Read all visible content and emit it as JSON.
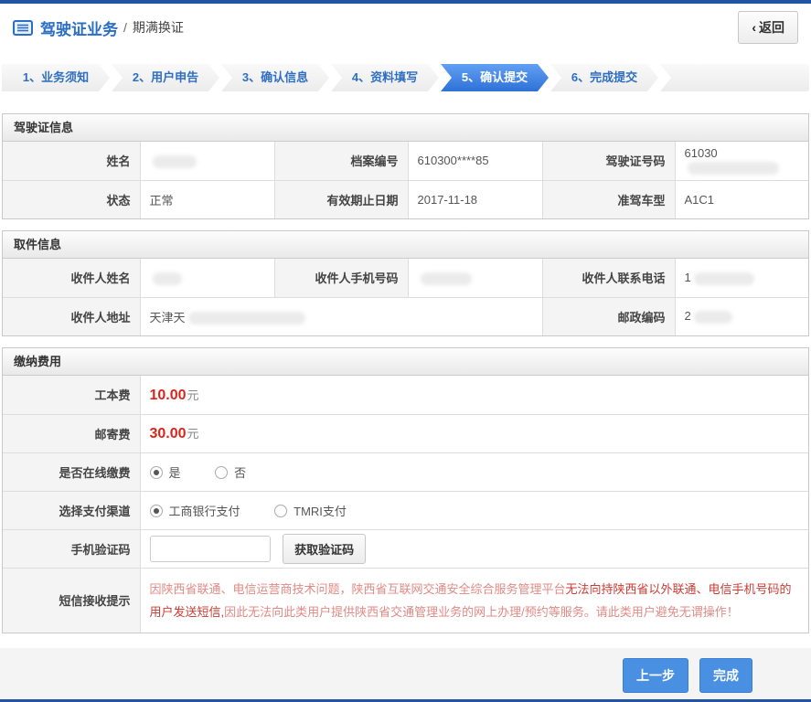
{
  "header": {
    "title": "驾驶证业务",
    "crumb_sep": "/",
    "subtitle": "期满换证",
    "back_arrow": "‹",
    "back_label": "返回"
  },
  "steps": [
    {
      "label": "1、业务须知",
      "active": false
    },
    {
      "label": "2、用户申告",
      "active": false
    },
    {
      "label": "3、确认信息",
      "active": false
    },
    {
      "label": "4、资料填写",
      "active": false
    },
    {
      "label": "5、确认提交",
      "active": true
    },
    {
      "label": "6、完成提交",
      "active": false
    }
  ],
  "license": {
    "title": "驾驶证信息",
    "fields": [
      {
        "label": "姓名",
        "value": "",
        "redacted": true
      },
      {
        "label": "档案编号",
        "value": "610300****85",
        "redacted": false
      },
      {
        "label": "驾驶证号码",
        "value": "61030",
        "redacted": true
      },
      {
        "label": "状态",
        "value": "正常",
        "redacted": false
      },
      {
        "label": "有效期止日期",
        "value": "2017-11-18",
        "redacted": false
      },
      {
        "label": "准驾车型",
        "value": "A1C1",
        "redacted": false
      }
    ]
  },
  "pickup": {
    "title": "取件信息",
    "fields": [
      {
        "label": "收件人姓名",
        "value": "",
        "redacted": true
      },
      {
        "label": "收件人手机号码",
        "value": "",
        "redacted": true
      },
      {
        "label": "收件人联系电话",
        "value": "1",
        "redacted": true
      },
      {
        "label": "收件人地址",
        "value": "天津天",
        "redacted": true
      },
      {
        "label": "邮政编码",
        "value": "2",
        "redacted": true
      }
    ]
  },
  "fees": {
    "title": "缴纳费用",
    "production_fee_label": "工本费",
    "production_fee_value": "10.00",
    "mailing_fee_label": "邮寄费",
    "mailing_fee_value": "30.00",
    "currency_unit": "元",
    "online_pay_label": "是否在线缴费",
    "online_yes": "是",
    "online_no": "否",
    "online_selected": "是",
    "channel_label": "选择支付渠道",
    "channel_icbc": "工商银行支付",
    "channel_tmri": "TMRI支付",
    "channel_selected": "工商银行支付",
    "captcha_label": "手机验证码",
    "captcha_value": "",
    "captcha_button_label": "获取验证码",
    "notice_label": "短信接收提示",
    "notice_part1": "因陕西省联通、电信运营商技术问题，陕西省互联网交通安全综合服务管理平台",
    "notice_part2": "无法向持陕西省以外联通、电信手机号码的用户发送短信,",
    "notice_part3": "因此无法向此类用户提供陕西省交通管理业务的网上办理/预约等服务。请此类用户避免无谓操作！"
  },
  "footer": {
    "prev_label": "上一步",
    "finish_label": "完成"
  },
  "colors": {
    "top_bar_blue": "#2155a4",
    "accent_blue": "#2a6ec5",
    "step_text_blue": "#2f6fc1",
    "step_active_blue": "#2e71d8",
    "fee_red": "#d9251d",
    "notice_light_red": "#e08a85",
    "notice_dark_red": "#cc3b33",
    "button_blue": "#4a90e2",
    "label_cell_gray": "#f4f4f4"
  }
}
